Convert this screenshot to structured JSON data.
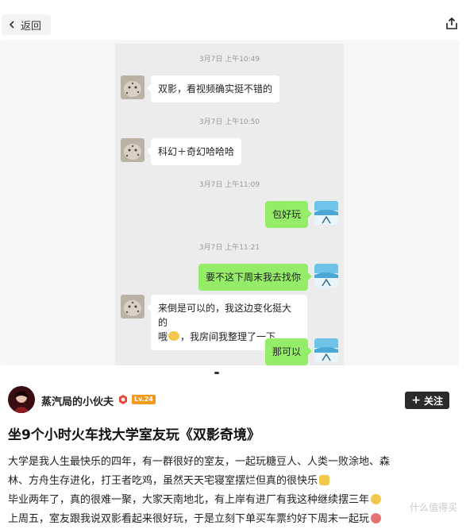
{
  "topbar": {
    "back_label": "返回"
  },
  "chat": {
    "messages": [
      {
        "time": "3月7日 上午10:49",
        "side": "left",
        "text": "双影，看视频确实挺不错的"
      },
      {
        "time": "3月7日 上午10:50",
        "side": "left",
        "text": "科幻＋奇幻哈哈哈"
      },
      {
        "time": "3月7日 上午11:09",
        "side": "right",
        "text": "包好玩"
      },
      {
        "time": "3月7日 上午11:21",
        "side": "right",
        "text": "要不这下周末我去找你"
      },
      {
        "side": "left",
        "text_line1": "来倒是可以的，我这边变化挺大的",
        "text_line2": "哦",
        "text_line2_rest": "，我房间我整理了一下"
      },
      {
        "side": "right",
        "text": "那可以"
      }
    ]
  },
  "author": {
    "name": "蒸汽局的小伙夫",
    "level": "Lv.24",
    "follow_label": "关注"
  },
  "post": {
    "title": "坐9个小时火车找大学室友玩《双影奇境》",
    "lines": [
      "大学是我人生最快乐的四年，有一群很好的室友，一起玩糖豆人、人类一败涂地、森",
      "林、方舟生存进化，打王者吃鸡，虽然天天宅寝室摆烂但真的很快乐",
      "毕业两年了，真的很难一聚，大家天南地北，有上岸有进厂有我这种继续摆三年",
      "上周五，室友跟我说双影看起来很好玩，于是立刻下单买车票约好下周末一起玩"
    ]
  },
  "colors": {
    "my_bubble": "#95ec69",
    "chat_bg": "#ececec",
    "follow_bg": "#2b2b2b"
  },
  "watermark": "什么值得买"
}
